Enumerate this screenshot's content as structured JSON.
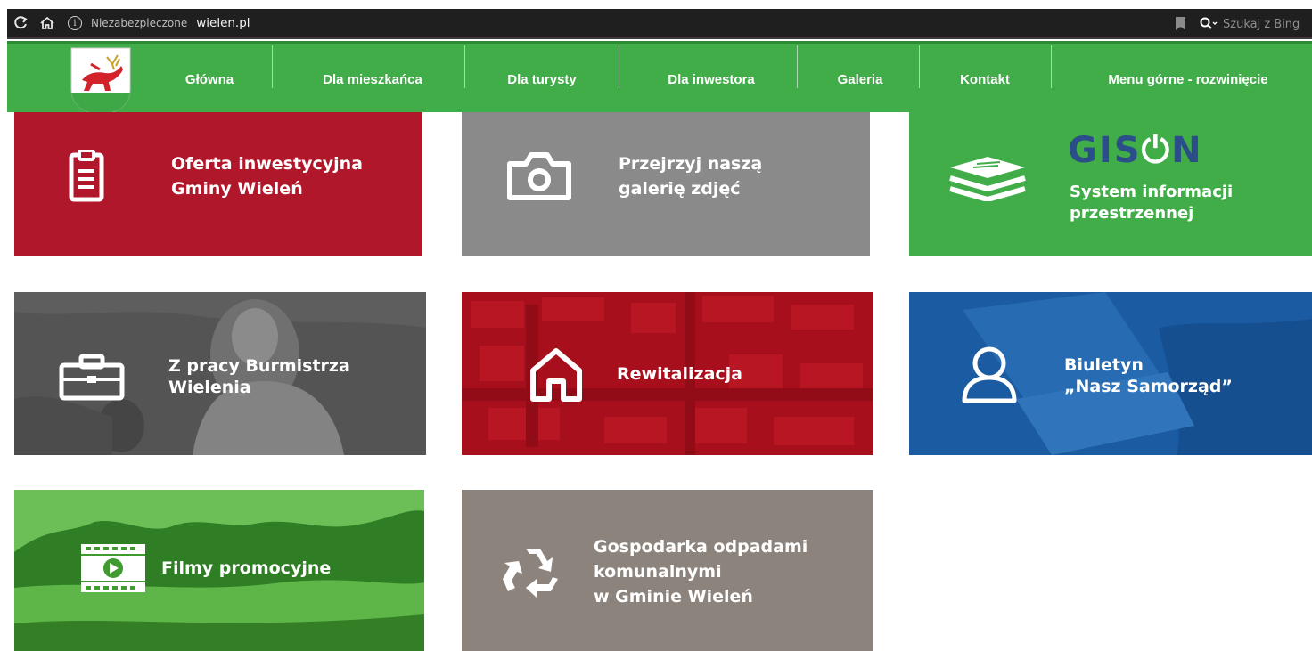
{
  "browser": {
    "security_label": "Niezabezpieczone",
    "url": "wielen.pl",
    "search_placeholder": "Szukaj z Bing",
    "icons": [
      "refresh-icon",
      "home-icon",
      "info-icon",
      "bookmark-icon",
      "search-icon"
    ]
  },
  "nav": {
    "items": [
      {
        "label": "Główna"
      },
      {
        "label": "Dla mieszkańca"
      },
      {
        "label": "Dla turysty"
      },
      {
        "label": "Dla inwestora"
      },
      {
        "label": "Galeria"
      },
      {
        "label": "Kontakt"
      },
      {
        "label": "Menu górne - rozwinięcie"
      }
    ]
  },
  "tiles": {
    "oferta": {
      "line1": "Oferta inwestycyjna",
      "line2": "Gminy Wieleń",
      "color": "#b0172b",
      "icon": "clipboard-icon"
    },
    "galeria": {
      "line1": "Przejrzyj naszą",
      "line2": "galerię zdjęć",
      "color": "#8a8a8a",
      "icon": "camera-icon"
    },
    "gison": {
      "logo": "GIS⏻N",
      "line1": "System informacji",
      "line2": "przestrzennej",
      "color": "#41ad49",
      "icon": "layers-icon"
    },
    "burmistrz": {
      "line1": "Z pracy Burmistrza",
      "line2": "Wielenia",
      "color": "#5a5a5a",
      "icon": "briefcase-icon"
    },
    "rewitalizacja": {
      "line1": "Rewitalizacja",
      "color": "#b3121f",
      "icon": "house-icon"
    },
    "biuletyn": {
      "line1": "Biuletyn",
      "line2": "„Nasz Samorząd”",
      "color": "#1f63a8",
      "icon": "user-icon"
    },
    "filmy": {
      "line1": "Filmy promocyjne",
      "color": "#3f9a2f",
      "icon": "video-icon"
    },
    "odpady": {
      "line1": "Gospodarka odpadami",
      "line2": "komunalnymi",
      "line3": "w Gminie Wieleń",
      "color": "#8c847c",
      "icon": "recycle-icon"
    }
  }
}
